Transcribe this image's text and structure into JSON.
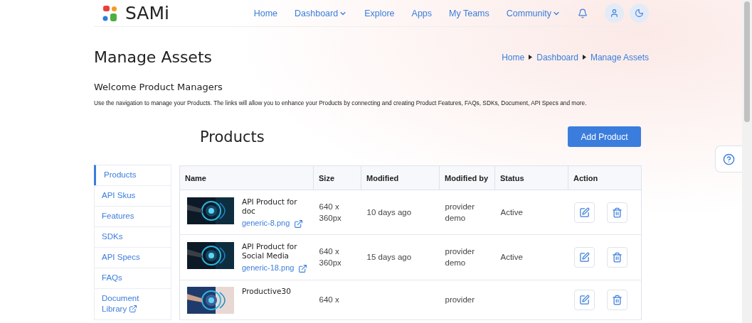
{
  "brand": {
    "name": "SAMi"
  },
  "nav": [
    {
      "label": "Home",
      "kind": "link"
    },
    {
      "label": "Dashboard",
      "kind": "dropdown"
    },
    {
      "label": "Explore",
      "kind": "link"
    },
    {
      "label": "Apps",
      "kind": "link"
    },
    {
      "label": "My Teams",
      "kind": "link"
    },
    {
      "label": "Community",
      "kind": "dropdown"
    }
  ],
  "page_title": "Manage Assets",
  "breadcrumb": [
    "Home",
    "Dashboard",
    "Manage Assets"
  ],
  "welcome": {
    "title": "Welcome Product Managers",
    "text": "Use the navigation to manage your Products. The links will allow you to enhance your Products by connecting and creating Product Features, FAQs, SDKs, Document, API Specs and more."
  },
  "section": {
    "title": "Products",
    "add_button": "Add Product"
  },
  "sidebar": {
    "items": [
      {
        "label": "Products",
        "selected": true,
        "external": false
      },
      {
        "label": "API Skus",
        "selected": false,
        "external": false
      },
      {
        "label": "Features",
        "selected": false,
        "external": false
      },
      {
        "label": "SDKs",
        "selected": false,
        "external": false
      },
      {
        "label": "API Specs",
        "selected": false,
        "external": false
      },
      {
        "label": "FAQs",
        "selected": false,
        "external": false
      },
      {
        "label": "Document Library",
        "selected": false,
        "external": true
      }
    ]
  },
  "table": {
    "columns": [
      "Name",
      "Size",
      "Modified",
      "Modified by",
      "Status",
      "Action"
    ],
    "rows": [
      {
        "name": "API Product for doc",
        "file": "generic-8.png",
        "size": "640 x 360px",
        "modified": "10 days ago",
        "modified_by": "provider demo",
        "status": "Active"
      },
      {
        "name": "API Product for Social Media",
        "file": "generic-18.png",
        "size": "640 x 360px",
        "modified": "15 days ago",
        "modified_by": "provider demo",
        "status": "Active"
      },
      {
        "name": "Productive30",
        "size": "640 x",
        "modified_by": "provider"
      }
    ]
  }
}
